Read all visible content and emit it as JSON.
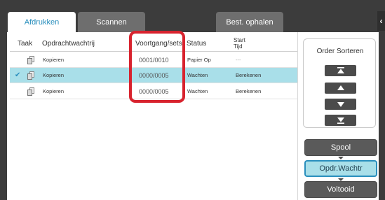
{
  "tabs": [
    {
      "label": "Afdrukken",
      "active": true
    },
    {
      "label": "Scannen",
      "active": false
    },
    {
      "label": "Best. ophalen",
      "active": false
    }
  ],
  "table": {
    "headers": {
      "taak": "Taak",
      "wachtrij": "Opdrachtwachtrij",
      "voortgang": "Voortgang/sets",
      "status": "Status",
      "start1": "Start",
      "start2": "Tijd"
    },
    "rows": [
      {
        "name": "Kopieren",
        "progress": "0001/0010",
        "status": "Papier Op",
        "time": "---",
        "selected": false
      },
      {
        "name": "Kopieren",
        "progress": "0000/0005",
        "status": "Wachten",
        "time": "Berekenen",
        "selected": true
      },
      {
        "name": "Kopieren",
        "progress": "0000/0005",
        "status": "Wachten",
        "time": "Berekenen",
        "selected": false
      }
    ]
  },
  "sort": {
    "title": "Order Sorteren",
    "buttons": [
      "move-top-icon",
      "move-up-icon",
      "move-down-icon",
      "move-bottom-icon"
    ]
  },
  "side_buttons": {
    "spool": "Spool",
    "queue": "Opdr.Wachtr",
    "done": "Voltooid"
  },
  "colors": {
    "accent": "#2a8fbd",
    "selected_row": "#a9dfe9",
    "highlight": "#d8232e",
    "dark": "#3c3c3c"
  }
}
